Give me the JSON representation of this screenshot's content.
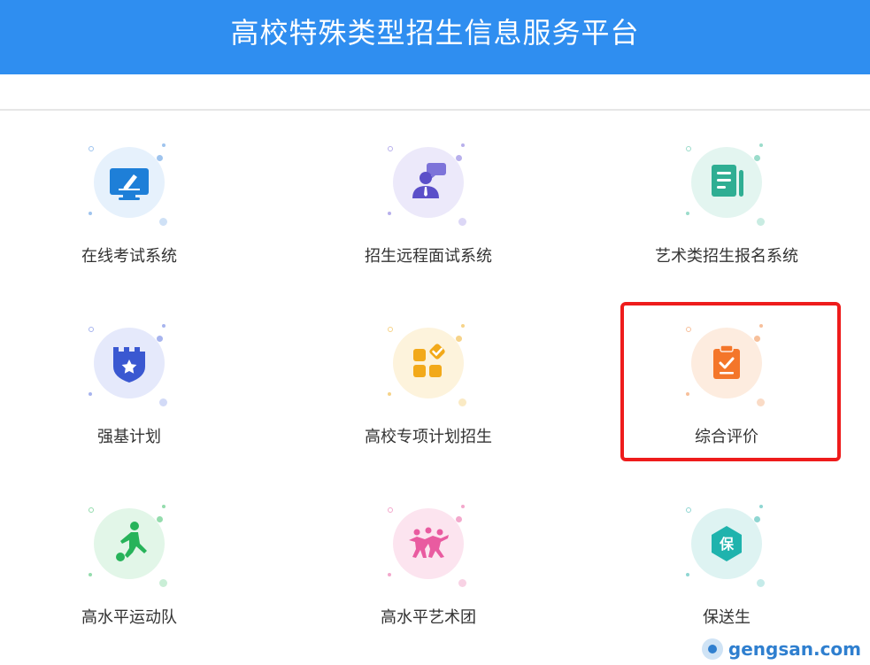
{
  "header": {
    "title": "高校特殊类型招生信息服务平台"
  },
  "systems": [
    {
      "label": "在线考试系统",
      "icon": "monitor-pen-icon",
      "color": "#1e7fd8",
      "bg": "#e6f1fc"
    },
    {
      "label": "招生远程面试系统",
      "icon": "interview-person-icon",
      "color": "#5b4fc9",
      "bg": "#ece9fa"
    },
    {
      "label": "艺术类招生报名系统",
      "icon": "document-form-icon",
      "color": "#2fae93",
      "bg": "#e3f5f0"
    },
    {
      "label": "强基计划",
      "icon": "shield-star-icon",
      "color": "#3a58d1",
      "bg": "#e5e9fb"
    },
    {
      "label": "高校专项计划招生",
      "icon": "grid-check-icon",
      "color": "#f2a91a",
      "bg": "#fdf3dc"
    },
    {
      "label": "综合评价",
      "icon": "clipboard-check-icon",
      "color": "#f4762a",
      "bg": "#fdecdf"
    },
    {
      "label": "高水平运动队",
      "icon": "soccer-player-icon",
      "color": "#27b35a",
      "bg": "#e2f6e8"
    },
    {
      "label": "高水平艺术团",
      "icon": "dancers-icon",
      "color": "#e95ba0",
      "bg": "#fce4ef"
    },
    {
      "label": "保送生",
      "icon": "hexagon-bao-icon",
      "color": "#1fb3ad",
      "bg": "#def3f2",
      "glyph_text": "保"
    }
  ],
  "highlight_color": "#ee1c1c",
  "watermark": "gengsan.com"
}
